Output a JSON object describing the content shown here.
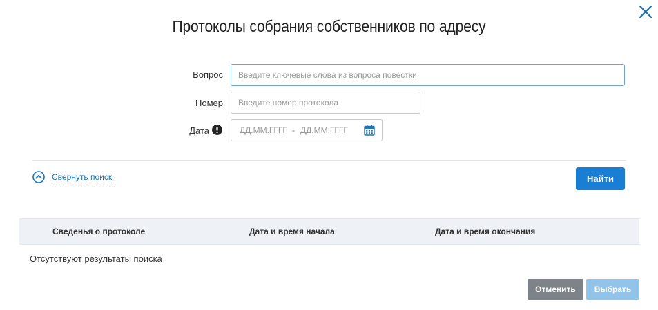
{
  "dialog": {
    "title": "Протоколы собрания собственников по адресу"
  },
  "form": {
    "question": {
      "label": "Вопрос",
      "placeholder": "Введите ключевые слова из вопроса повестки",
      "value": ""
    },
    "number": {
      "label": "Номер",
      "placeholder": "Введите номер протокола",
      "value": ""
    },
    "date": {
      "label": "Дата",
      "from_placeholder": "ДД.ММ.ГГГГ",
      "separator": "-",
      "to_placeholder": "ДД.ММ.ГГГГ"
    }
  },
  "actions": {
    "collapse_label": "Свернуть поиск",
    "find_label": "Найти"
  },
  "table": {
    "columns": [
      "Сведенья о протоколе",
      "Дата и время начала",
      "Дата и время окончания"
    ],
    "empty_text": "Отсутствуют результаты поиска"
  },
  "footer": {
    "cancel_label": "Отменить",
    "select_label": "Выбрать"
  },
  "icons": {
    "close": "close-icon",
    "warning": "warning-icon",
    "calendar": "calendar-icon",
    "collapse": "chevron-up-circle-icon"
  },
  "colors": {
    "primary": "#1a7fd4",
    "link": "#1a73b8",
    "cancel": "#7d8389",
    "select_disabled": "#92c4ea",
    "header_bg": "#eef2f6"
  }
}
